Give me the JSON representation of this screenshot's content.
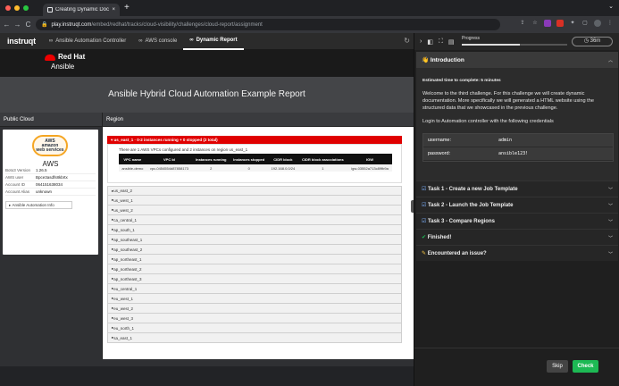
{
  "browser": {
    "tab_title": "Creating Dynamic Documentation",
    "url_host": "play.instruqt.com",
    "url_path": "/embed/redhat/tracks/cloud-visibility/challenges/cloud-report/assignment"
  },
  "instruqt": {
    "logo": "instruqt",
    "tabs": [
      {
        "label": "Ansible Automation Controller"
      },
      {
        "label": "AWS console"
      },
      {
        "label": "Dynamic Report"
      }
    ]
  },
  "report": {
    "brand_line1": "Red Hat",
    "brand_line2": "Ansible",
    "title": "Ansible Hybrid Cloud Automation Example Report",
    "col_left": "Public Cloud",
    "col_right": "Region",
    "aws": {
      "logo_line1": "AWS",
      "logo_line2": "amazon",
      "logo_line3": "web services",
      "label": "AWS",
      "info": [
        {
          "k": "Boto3 Version",
          "v": "1.26.5"
        },
        {
          "k": "AWS user",
          "v": "Bpce3asdfs8kbrtx"
        },
        {
          "k": "Account ID",
          "v": "064151638034"
        },
        {
          "k": "Account Alias",
          "v": "unknown"
        }
      ],
      "info_button": "Ansible Automation Info"
    },
    "active_region": "us_east_1 · 0-2 instances running + 0 stopped (2 total)",
    "region_note": "There are 1 AWS VPCs configured and 2 instances on region us_east_1",
    "vpc_headers": [
      "VPC name",
      "VPC Id",
      "Instances running",
      "Instances stopped",
      "CIDR block",
      "CIDR block associations",
      "IGW"
    ],
    "vpc_row": [
      "ansible-demo",
      "vpc-0454554d87858173",
      "2",
      "0",
      "192.168.0.0/24",
      "1",
      "igw-03552a713c89fb9a"
    ],
    "regions": [
      "us_east_2",
      "us_west_1",
      "us_west_2",
      "ca_central_1",
      "ap_south_1",
      "ap_southeast_1",
      "ap_southeast_2",
      "ap_northeast_1",
      "ap_northeast_2",
      "ap_northeast_3",
      "eu_central_1",
      "eu_west_1",
      "eu_west_2",
      "eu_west_3",
      "eu_north_1",
      "sa_east_1"
    ]
  },
  "sidebar": {
    "progress_label": "Progress",
    "progress_fraction": 0.55,
    "timer": "36m",
    "intro_title": "Introduction",
    "estimated": "Estimated time to complete: 5 minutes",
    "paragraph": "Welcome to the third challenge. For this challenge we will create dynamic documentation. More specifically we will generated a HTML website using the structured data that we showcased in the previous challenge.",
    "login": "Login to Automation controller with the following credentials",
    "creds": [
      {
        "k": "username:",
        "v": "admin"
      },
      {
        "k": "password:",
        "v": "ansible123!"
      }
    ],
    "tasks": [
      {
        "label": "Task 1 - Create a new Job Template"
      },
      {
        "label": "Task 2 - Launch the Job Template"
      },
      {
        "label": "Task 3 - Compare Regions"
      },
      {
        "label": "Finished!"
      },
      {
        "label": "Encountered an issue?"
      }
    ],
    "skip": "Skip",
    "check": "Check"
  }
}
